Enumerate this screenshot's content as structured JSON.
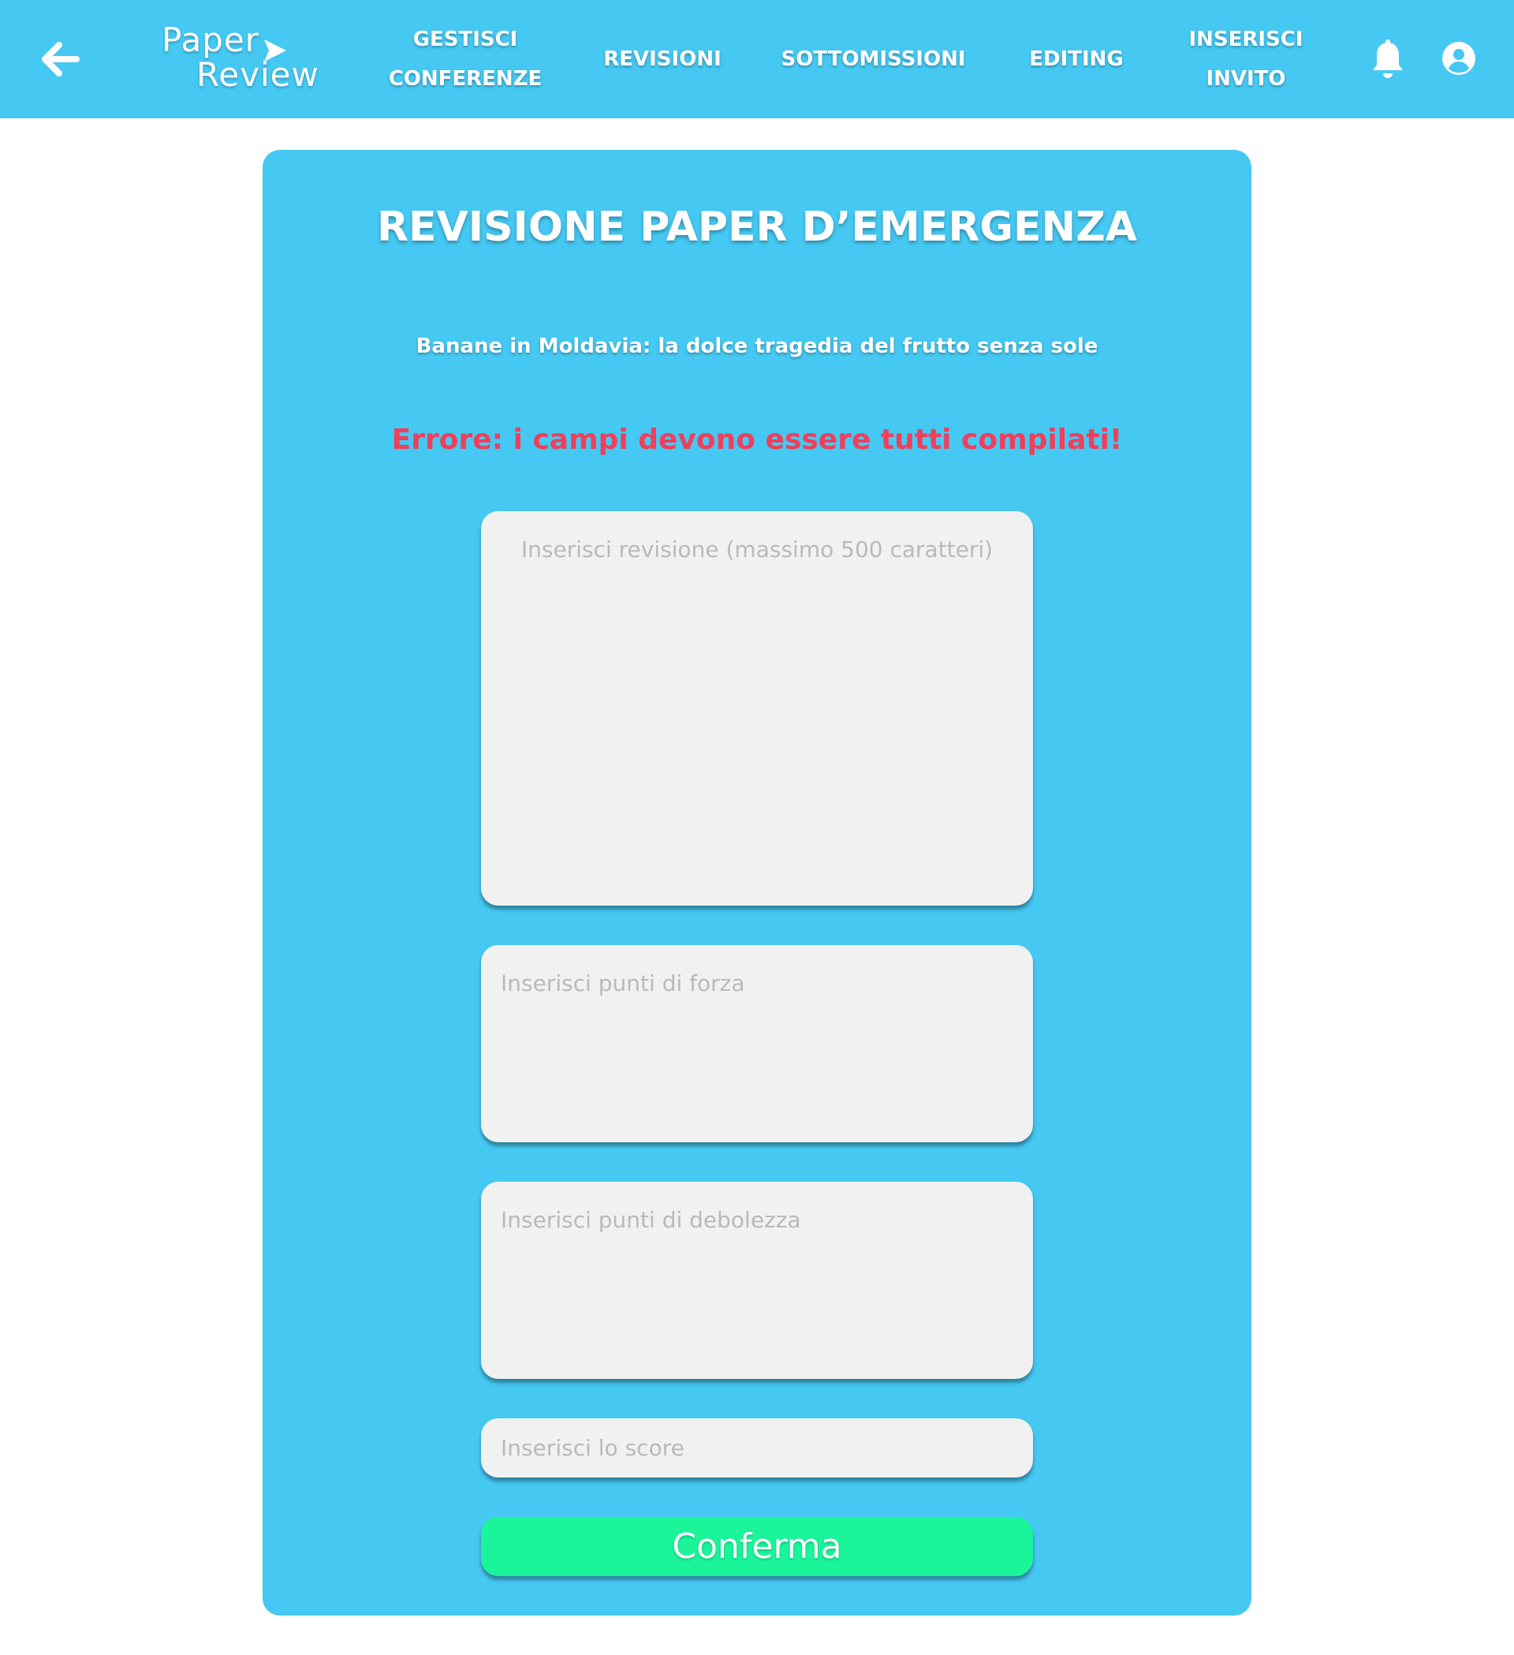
{
  "header": {
    "logo_line1": "Paper",
    "logo_line2": "Review",
    "nav": {
      "gestisci_conferenze": [
        "GESTISCI",
        "CONFERENZE"
      ],
      "revisioni": "REVISIONI",
      "sottomissioni": "SOTTOMISSIONI",
      "editing": "EDITING",
      "inserisci_invito": [
        "INSERISCI",
        "INVITO"
      ]
    },
    "icons": [
      "back-arrow-icon",
      "paper-plane-icon",
      "bell-icon",
      "account-icon"
    ]
  },
  "form": {
    "title": "REVISIONE PAPER D’EMERGENZA",
    "paper_title": "Banane in Moldavia: la dolce tragedia del frutto senza sole",
    "error_message": "Errore: i campi devono essere tutti compilati!",
    "review_placeholder": "Inserisci revisione (massimo 500 caratteri)",
    "strengths_placeholder": "Inserisci punti di forza",
    "weaknesses_placeholder": "Inserisci punti di debolezza",
    "score_placeholder": "Inserisci lo score",
    "confirm_label": "Conferma"
  },
  "colors": {
    "primary": "#45c8f2",
    "error": "#ef3f5b",
    "confirm": "#1af59a",
    "field": "#f1f1f1",
    "background": "#ffffff"
  }
}
